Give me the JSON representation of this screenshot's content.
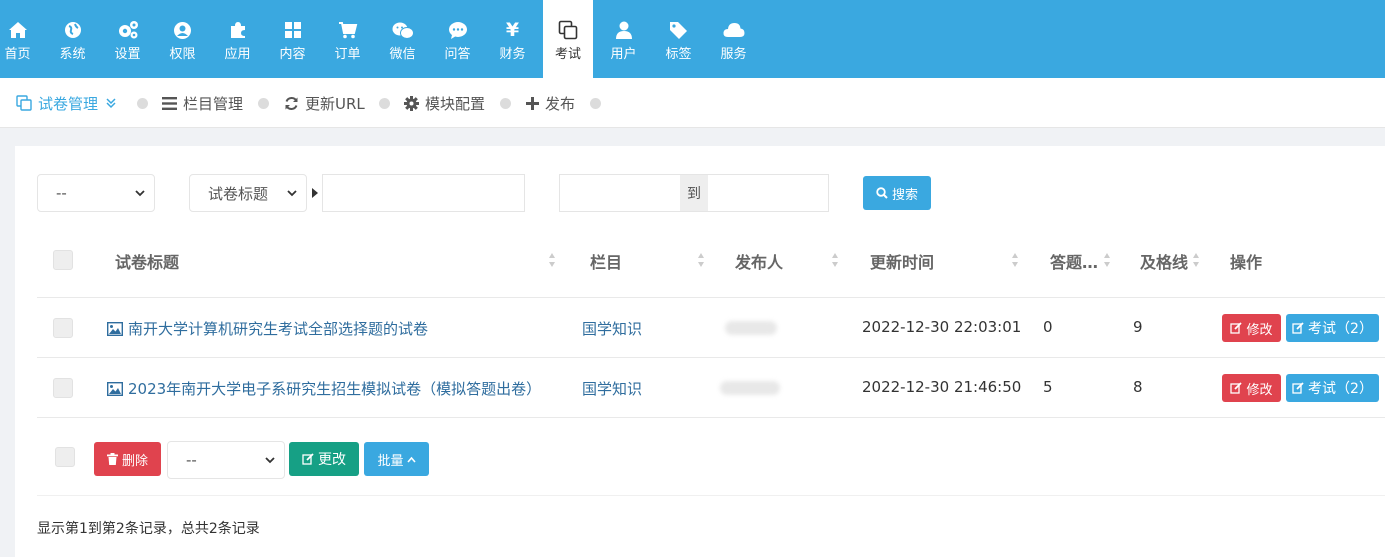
{
  "nav": {
    "items": [
      {
        "label": "首页",
        "icon": "home-icon"
      },
      {
        "label": "系统",
        "icon": "globe-icon"
      },
      {
        "label": "设置",
        "icon": "cogs-icon"
      },
      {
        "label": "权限",
        "icon": "user-circle-icon"
      },
      {
        "label": "应用",
        "icon": "puzzle-icon"
      },
      {
        "label": "内容",
        "icon": "grid-icon"
      },
      {
        "label": "订单",
        "icon": "cart-icon"
      },
      {
        "label": "微信",
        "icon": "wechat-icon"
      },
      {
        "label": "问答",
        "icon": "chat-icon"
      },
      {
        "label": "财务",
        "icon": "yen-icon"
      },
      {
        "label": "考试",
        "icon": "copy-icon",
        "active": true
      },
      {
        "label": "用户",
        "icon": "user-icon"
      },
      {
        "label": "标签",
        "icon": "tag-icon"
      },
      {
        "label": "服务",
        "icon": "cloud-icon"
      }
    ]
  },
  "subnav": {
    "paper_manage": "试卷管理",
    "column_manage": "栏目管理",
    "update_url": "更新URL",
    "module_config": "模块配置",
    "publish": "发布"
  },
  "filters": {
    "column_select": "--",
    "field_select": "试卷标题",
    "keyword_value": "",
    "to_label": "到",
    "search_label": "搜索"
  },
  "table": {
    "headers": {
      "title": "试卷标题",
      "column": "栏目",
      "author": "发布人",
      "updated": "更新时间",
      "answers": "答题…",
      "pass": "及格线",
      "actions": "操作"
    },
    "rows": [
      {
        "title": "南开大学计算机研究生考试全部选择题的试卷",
        "column": "国学知识",
        "updated": "2022-12-30 22:03:01",
        "answers": "0",
        "pass": "9",
        "edit": "修改",
        "exam": "考试（2）"
      },
      {
        "title": "2023年南开大学电子系研究生招生模拟试卷（模拟答题出卷）",
        "column": "国学知识",
        "updated": "2022-12-30 21:46:50",
        "answers": "5",
        "pass": "8",
        "edit": "修改",
        "exam": "考试（2）"
      }
    ]
  },
  "bulk": {
    "delete_label": "删除",
    "select_value": "--",
    "change_label": "更改",
    "batch_label": "批量"
  },
  "pagination": {
    "summary": "显示第1到第2条记录，总共2条记录"
  },
  "colors": {
    "primary": "#3aa8e0",
    "danger": "#e0434e",
    "success": "#16a085"
  }
}
